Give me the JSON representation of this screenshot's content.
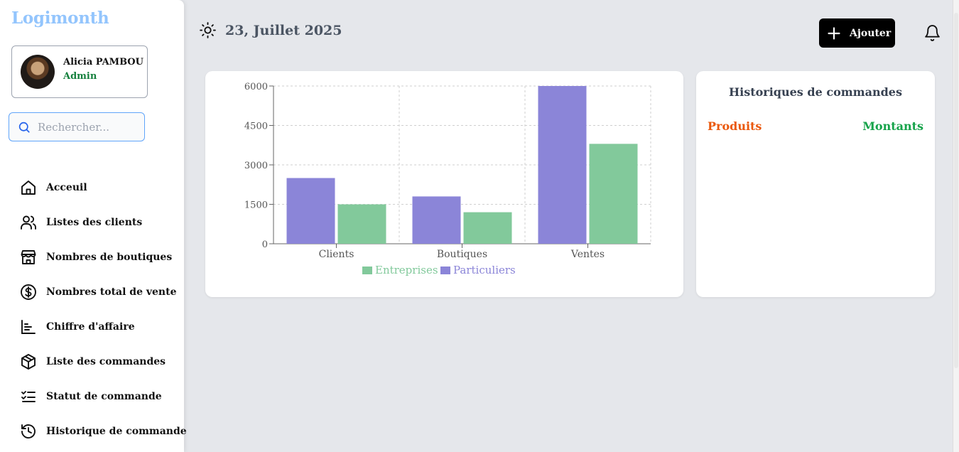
{
  "app": {
    "title": "Logimonth"
  },
  "user": {
    "name": "Alicia PAMBOU",
    "role": "Admin"
  },
  "search": {
    "placeholder": "Rechercher..."
  },
  "sidebar": {
    "items": [
      {
        "label": "Acceuil",
        "icon": "home-icon"
      },
      {
        "label": "Listes des clients",
        "icon": "users-icon"
      },
      {
        "label": "Nombres de boutiques",
        "icon": "store-icon"
      },
      {
        "label": "Nombres total de vente",
        "icon": "dollar-circle-icon"
      },
      {
        "label": "Chiffre d'affaire",
        "icon": "bar-chart-icon"
      },
      {
        "label": "Liste des commandes",
        "icon": "package-icon"
      },
      {
        "label": "Statut de commande",
        "icon": "list-checks-icon"
      },
      {
        "label": "Historique de commande",
        "icon": "history-icon"
      }
    ]
  },
  "header": {
    "date": "23, Juillet 2025",
    "add_label": "Ajouter"
  },
  "history": {
    "title": "Historiques de commandes",
    "col_products": "Produits",
    "col_amounts": "Montants"
  },
  "colors": {
    "particuliers": "#8b85d8",
    "entreprises": "#82c99b",
    "logo": "#93c5fd",
    "role": "#15803d",
    "produits": "#ea580c",
    "montants": "#16a34a"
  },
  "chart_data": {
    "type": "bar",
    "categories": [
      "Clients",
      "Boutiques",
      "Ventes"
    ],
    "series": [
      {
        "name": "Particuliers",
        "values": [
          2500,
          1800,
          6050
        ]
      },
      {
        "name": "Entreprises",
        "values": [
          1500,
          1200,
          3800
        ]
      }
    ],
    "ylim": [
      0,
      6000
    ],
    "yticks": [
      "0",
      "1500",
      "3000",
      "4500",
      "6000"
    ],
    "grid": true,
    "legend": [
      "Entreprises",
      "Particuliers"
    ],
    "legend_position": "bottom"
  }
}
